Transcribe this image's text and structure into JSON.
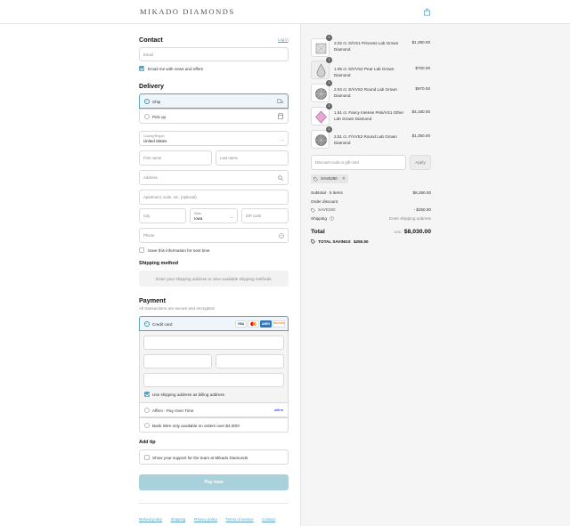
{
  "header": {
    "logo": "MIKADO DIAMONDS",
    "bag_icon": "shopping-bag-icon"
  },
  "contact": {
    "heading": "Contact",
    "login_link": "Log in",
    "email_placeholder": "Email",
    "news_label": "Email me with news and offers",
    "news_checked": true
  },
  "delivery": {
    "heading": "Delivery",
    "options": [
      {
        "label": "Ship",
        "selected": true,
        "icon": "truck-icon"
      },
      {
        "label": "Pick up",
        "selected": false,
        "icon": "store-icon"
      }
    ],
    "country_label": "Country/Region",
    "country_value": "United States",
    "first_name": "First name",
    "last_name": "Last name",
    "address": "Address",
    "apartment": "Apartment, suite, etc. (optional)",
    "city": "City",
    "state_label": "State",
    "state_value": "Iowa",
    "zip": "ZIP code",
    "phone": "Phone",
    "save_label": "Save this information for next time"
  },
  "shipping": {
    "heading": "Shipping method",
    "message": "Enter your shipping address to view available shipping methods."
  },
  "payment": {
    "heading": "Payment",
    "subtitle": "All transactions are secure and encrypted.",
    "credit_card": "Credit card",
    "cards": [
      {
        "name": "VISA",
        "color": "#1a1f71"
      },
      {
        "name": "MC",
        "color": "#eb001b"
      },
      {
        "name": "AMEX",
        "color": "#2e77bc"
      },
      {
        "name": "DISCOVER",
        "color": "#f58220"
      }
    ],
    "billing_label": "Use shipping address as billing address",
    "affirm_label": "Affirm - Pay Over Time",
    "affirm_logo": "affirm",
    "bank_wire_label": "Bank Wire only available on orders over $4,000!"
  },
  "tip": {
    "heading": "Add tip",
    "label": "Show your support for the team at Mikado Diamonds"
  },
  "pay_button": "Pay now",
  "footer_links": [
    "Refund policy",
    "Shipping",
    "Privacy policy",
    "Terms of service",
    "Contact"
  ],
  "order": {
    "items": [
      {
        "qty": "1",
        "name": "2.02 ct. D/VS1 Princess Lab Grown Diamond",
        "price": "$1,380.00",
        "thumb": "princess"
      },
      {
        "qty": "1",
        "name": "1.05 ct. D/VVS2 Pear Lab Grown Diamond",
        "price": "$700.00",
        "thumb": "pear"
      },
      {
        "qty": "1",
        "name": "2.04 ct. E/VVS2 Round Lab Grown Diamond",
        "price": "$970.00",
        "thumb": "round"
      },
      {
        "qty": "1",
        "name": "1.51 ct. Fancy Intense Pink/VS1 Other Lab Grown Diamond",
        "price": "$4,180.00",
        "thumb": "pink"
      },
      {
        "qty": "1",
        "name": "2.51 ct. F/VVS2 Round Lab Grown Diamond",
        "price": "$1,350.00",
        "thumb": "round"
      }
    ],
    "discount_placeholder": "Discount code or gift card",
    "apply": "Apply",
    "code_tag": "SAVE250",
    "subtotal_label": "Subtotal · 5 items",
    "subtotal_value": "$8,280.00",
    "order_discount_label": "Order discount",
    "discount_code": "SAVE250",
    "discount_value": "- $250.00",
    "shipping_label": "Shipping",
    "shipping_value": "Enter shipping address",
    "total_label": "Total",
    "currency": "USD",
    "total_value": "$8,030.00",
    "savings_label": "TOTAL SAVINGS",
    "savings_value": "$250.00"
  },
  "colors": {
    "accent": "#5aa2bf",
    "button": "#a9d1dc",
    "panel": "#f5f5f5"
  }
}
